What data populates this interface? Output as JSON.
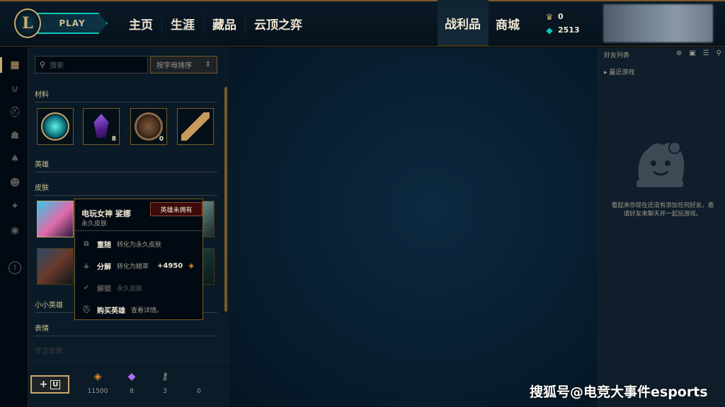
{
  "header": {
    "logo": "L",
    "play_label": "PLAY",
    "nav": [
      "主页",
      "生涯",
      "藏品",
      "云顶之弈"
    ],
    "nav_right": [
      "战利品",
      "商城"
    ],
    "active_tab": "战利品",
    "rp": "0",
    "be": "2513"
  },
  "rail": {
    "icons": [
      "grid-icon",
      "chest-icon",
      "helmet-icon",
      "mask-icon",
      "ward-icon",
      "emote-icon",
      "spell-icon",
      "profile-icon",
      "help-icon"
    ]
  },
  "loot": {
    "search_placeholder": "搜索",
    "sort_label": "按字母排序",
    "sections": {
      "materials": "材料",
      "champions": "英雄",
      "skins": "皮肤",
      "little_legends": "小小英雄",
      "emotes": "表情",
      "wards": "守卫皮肤"
    },
    "materials": [
      {
        "name": "emote-token",
        "count": ""
      },
      {
        "name": "gemstone",
        "count": "8"
      },
      {
        "name": "hextech-chest",
        "count": "0"
      },
      {
        "name": "hextech-key",
        "count": ""
      }
    ]
  },
  "popover": {
    "name": "电玩女神 娑娜",
    "type": "永久皮肤",
    "badge": "英雄未拥有",
    "actions": [
      {
        "label": "重随",
        "desc": "转化为永久皮肤",
        "icon": "reroll-icon",
        "disabled": false
      },
      {
        "label": "分解",
        "desc": "转化为精萃",
        "gain": "+4950",
        "icon": "disenchant-icon",
        "disabled": false
      },
      {
        "label": "解锁",
        "desc": "永久皮肤",
        "icon": "check-icon",
        "disabled": true
      },
      {
        "label": "购买英雄",
        "desc": "查看详情。",
        "icon": "helmet-icon",
        "disabled": false
      }
    ]
  },
  "bottom": {
    "orange_essence": "11500",
    "gemstones": "8",
    "keys": "3",
    "key_fragments": "0"
  },
  "friends": {
    "title": "好友列表",
    "recent": "最近游戏",
    "empty_message": "看起来你现在还没有添加任何好友。邀请好友来聊天并一起玩游戏。"
  },
  "watermark": "搜狐号@电竞大事件esports",
  "colors": {
    "gold": "#c8aa6e",
    "teal": "#0ac8b9",
    "bg": "#010a13"
  }
}
